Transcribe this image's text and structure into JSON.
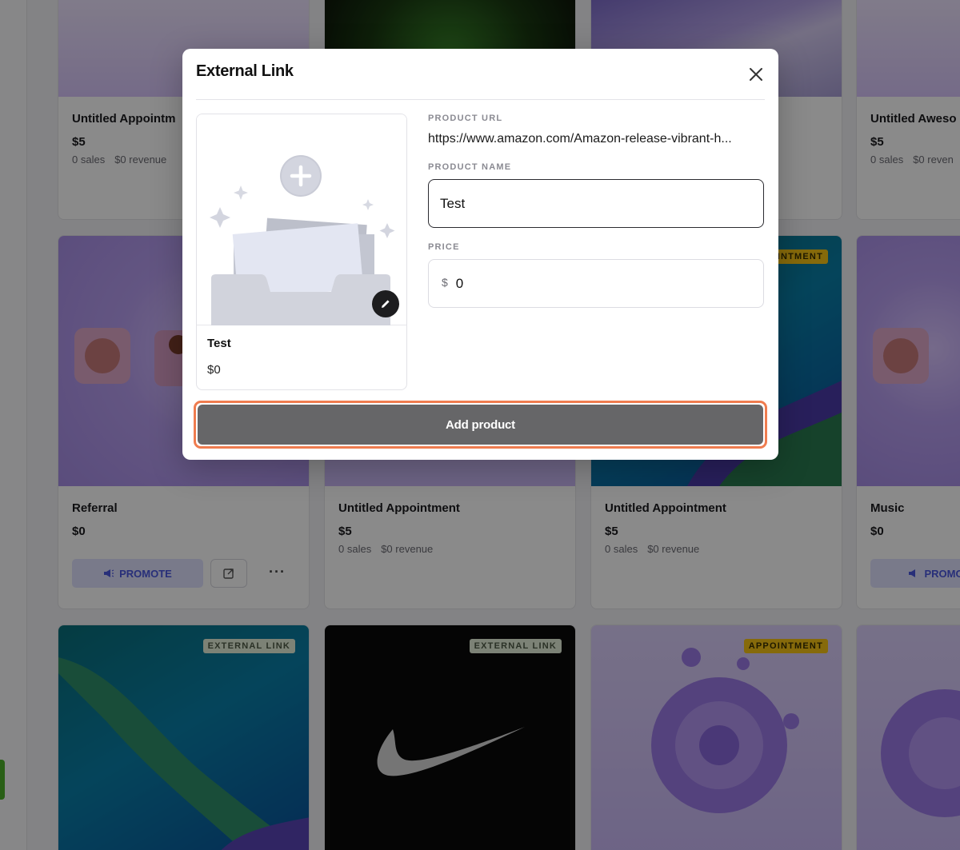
{
  "colors": {
    "overlay": "rgba(0,0,0,0.46)",
    "add_button_bg": "#666668",
    "add_button_focus_ring": "#ef7c4f",
    "promote_text": "#4a57e0",
    "badge_external_bg": "#e6f0da",
    "badge_appointment_bg": "#f7c515"
  },
  "background": {
    "row1": [
      {
        "title": "Untitled Appointm",
        "price": "$5",
        "sales": "0 sales",
        "revenue": "$0 revenue"
      },
      {
        "title": "Untitled Aweso",
        "price": "$5",
        "sales": "0 sales",
        "revenue": "$0 reven"
      }
    ],
    "row2": [
      {
        "title": "Referral",
        "price": "$0",
        "promote": "PROMOTE",
        "more": "···"
      },
      {
        "title": "Untitled Appointment",
        "price": "$5",
        "sales": "0 sales",
        "revenue": "$0 revenue"
      },
      {
        "title": "Untitled Appointment",
        "price": "$5",
        "sales": "0 sales",
        "revenue": "$0 revenue",
        "badge": "APPOINTMENT"
      },
      {
        "title": "Music",
        "price": "$0",
        "promote": "PROMO"
      }
    ],
    "row3": [
      {
        "badge": "EXTERNAL LINK"
      },
      {
        "badge": "EXTERNAL LINK"
      },
      {
        "badge": "APPOINTMENT"
      }
    ],
    "badge_partial": "INTMENT"
  },
  "modal": {
    "title": "External Link",
    "close_icon": "close-icon",
    "preview": {
      "name": "Test",
      "price": "$0",
      "edit_icon": "pencil-icon"
    },
    "url_label": "PRODUCT URL",
    "url_value": "https://www.amazon.com/Amazon-release-vibrant-h...",
    "name_label": "PRODUCT NAME",
    "name_value": "Test",
    "price_label": "PRICE",
    "currency": "$",
    "price_value": "0",
    "add_button": "Add product"
  }
}
